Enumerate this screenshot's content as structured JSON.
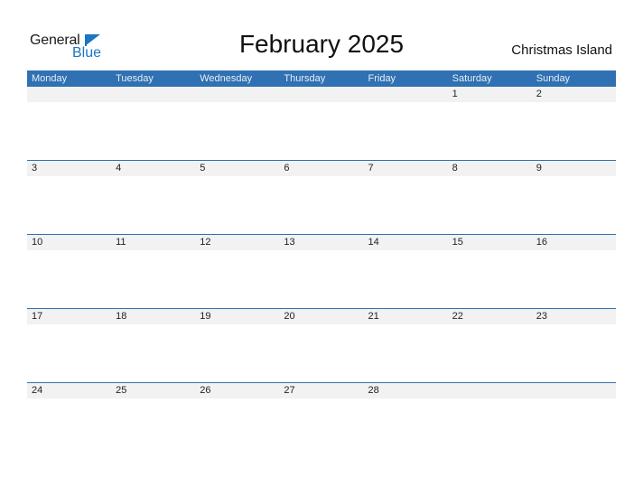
{
  "logo": {
    "line1": "General",
    "line2": "Blue"
  },
  "title": "February 2025",
  "country": "Christmas Island",
  "colors": {
    "header_bg": "#2f71b2",
    "accent": "#1b76c4",
    "row_bg": "#f2f2f2"
  },
  "weekdays": [
    "Monday",
    "Tuesday",
    "Wednesday",
    "Thursday",
    "Friday",
    "Saturday",
    "Sunday"
  ],
  "weeks": [
    [
      "",
      "",
      "",
      "",
      "",
      "1",
      "2"
    ],
    [
      "3",
      "4",
      "5",
      "6",
      "7",
      "8",
      "9"
    ],
    [
      "10",
      "11",
      "12",
      "13",
      "14",
      "15",
      "16"
    ],
    [
      "17",
      "18",
      "19",
      "20",
      "21",
      "22",
      "23"
    ],
    [
      "24",
      "25",
      "26",
      "27",
      "28",
      "",
      ""
    ]
  ]
}
